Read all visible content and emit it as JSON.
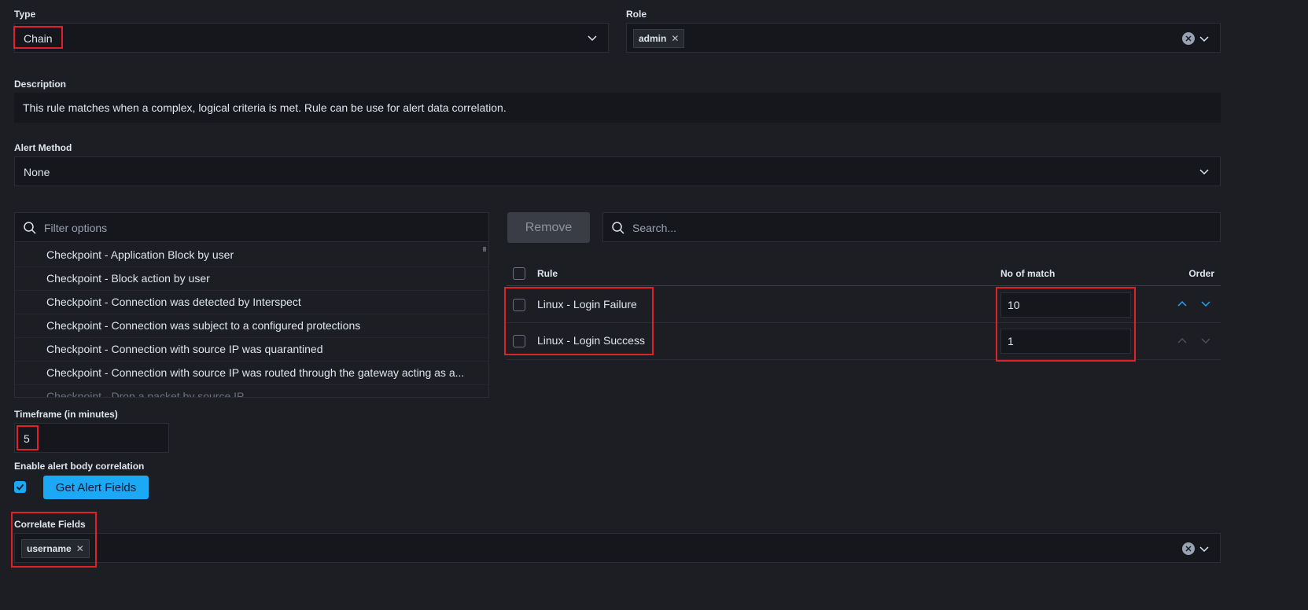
{
  "type": {
    "label": "Type",
    "value": "Chain"
  },
  "role": {
    "label": "Role",
    "tags": [
      "admin"
    ]
  },
  "description": {
    "label": "Description",
    "text": "This rule matches when a complex, logical criteria is met. Rule can be use for alert data correlation."
  },
  "alert_method": {
    "label": "Alert Method",
    "value": "None"
  },
  "filter": {
    "placeholder": "Filter options",
    "options": [
      "Checkpoint - Application Block by user",
      "Checkpoint - Block action by user",
      "Checkpoint - Connection was detected by Interspect",
      "Checkpoint - Connection was subject to a configured protections",
      "Checkpoint - Connection with source IP was quarantined",
      "Checkpoint - Connection with source IP was routed through the gateway acting as a...",
      "Checkpoint - Drop a packet by source IP"
    ]
  },
  "remove_button": "Remove",
  "search": {
    "placeholder": "Search..."
  },
  "rules_table": {
    "headers": {
      "rule": "Rule",
      "matches": "No of match",
      "order": "Order"
    },
    "rows": [
      {
        "rule": "Linux - Login Failure",
        "matches": "10"
      },
      {
        "rule": "Linux - Login Success",
        "matches": "1"
      }
    ]
  },
  "timeframe": {
    "label": "Timeframe (in minutes)",
    "value": "5"
  },
  "body_correlation": {
    "label": "Enable alert body correlation",
    "checked": true,
    "button": "Get Alert Fields"
  },
  "correlate": {
    "label": "Correlate Fields",
    "tags": [
      "username"
    ]
  },
  "colors": {
    "accent": "#1ba9f5",
    "highlight": "#e0202a",
    "background": "#1d1e24"
  }
}
